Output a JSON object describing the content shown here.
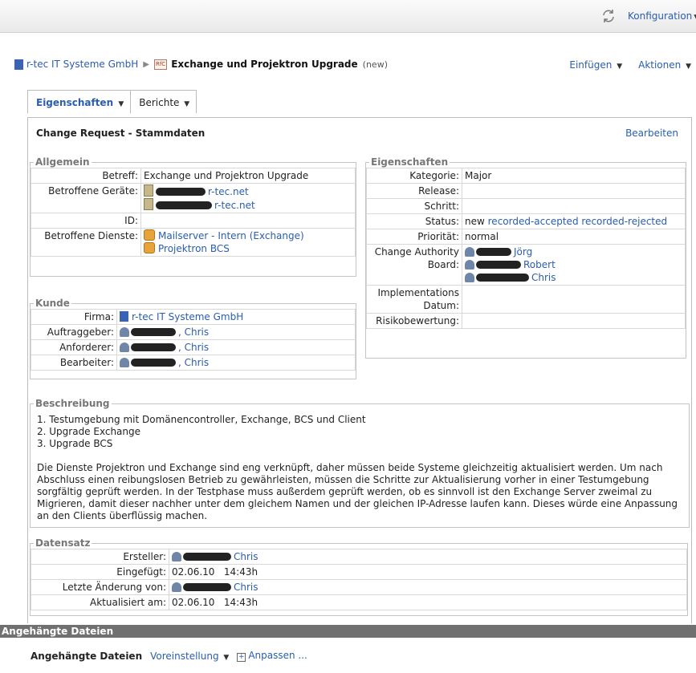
{
  "topbar": {
    "konfiguration": "Konfiguration"
  },
  "breadcrumb": {
    "company": "r-tec IT Systeme GmbH",
    "rfc_badge": "RfC",
    "title": "Exchange und Projektron Upgrade",
    "state": "(new)"
  },
  "actions": {
    "insert": "Einfügen",
    "actions": "Aktionen"
  },
  "tabs": {
    "properties": "Eigenschaften",
    "reports": "Berichte"
  },
  "panel": {
    "title": "Change Request - Stammdaten",
    "edit": "Bearbeiten"
  },
  "allgemein": {
    "legend": "Allgemein",
    "betreff_label": "Betreff:",
    "betreff_value": "Exchange und Projektron Upgrade",
    "geraete_label": "Betroffene Geräte:",
    "geraet1": "r-tec.net",
    "geraet2": "r-tec.net",
    "id_label": "ID:",
    "dienste_label": "Betroffene Dienste:",
    "dienst1": "Mailserver - Intern (Exchange)",
    "dienst2": "Projektron BCS"
  },
  "kunde": {
    "legend": "Kunde",
    "firma_label": "Firma:",
    "firma_value": "r-tec IT Systeme GmbH",
    "auftraggeber_label": "Auftraggeber:",
    "auftraggeber_value": ", Chris",
    "anforderer_label": "Anforderer:",
    "anforderer_value": ", Chris",
    "bearbeiter_label": "Bearbeiter:",
    "bearbeiter_value": ", Chris"
  },
  "eigenschaften": {
    "legend": "Eigenschaften",
    "kategorie_label": "Kategorie:",
    "kategorie_value": "Major",
    "release_label": "Release:",
    "schritt_label": "Schritt:",
    "status_label": "Status:",
    "status_current": "new",
    "status_opt1": "recorded-accepted",
    "status_opt2": "recorded-rejected",
    "prioritaet_label": "Priorität:",
    "prioritaet_value": "normal",
    "cab_label": "Change Authority Board:",
    "cab1": "Jörg",
    "cab2": "Robert",
    "cab3": "Chris",
    "impl_label": "Implementations Datum:",
    "risiko_label": "Risikobewertung:"
  },
  "beschreibung": {
    "legend": "Beschreibung",
    "line1": "1. Testumgebung mit Domänencontroller, Exchange, BCS und Client",
    "line2": "2. Upgrade Exchange",
    "line3": "3. Upgrade BCS",
    "paragraph": "Die Dienste Projektron und Exchange sind eng verknüpft, daher müssen beide Systeme gleichzeitig aktualisiert werden. Um nach Abschluss einen reibungslosen Betrieb zu gewährleisten, müssen die Schritte zur Aktualisierung vorher in einer Testumgebung sorgfältig geprüft werden. In der Testphase muss außerdem geprüft werden, ob es sinnvoll ist den Exchange Server zweimal zu Migrieren, damit dieser nachher unter dem gleichem Namen und der gleichen IP-Adresse laufen kann. Dieses würde eine Anpassung an den Clients überflüssig machen."
  },
  "datensatz": {
    "legend": "Datensatz",
    "ersteller_label": "Ersteller:",
    "ersteller_value": "Chris",
    "eingefuegt_label": "Eingefügt:",
    "eingefuegt_value": "02.06.10   14:43h",
    "letzte_label": "Letzte Änderung von:",
    "letzte_value": "Chris",
    "aktualisiert_label": "Aktualisiert am:",
    "aktualisiert_value": "02.06.10   14:43h"
  },
  "attachments": {
    "bar": "Angehängte Dateien",
    "title": "Angehängte Dateien",
    "preset": "Voreinstellung",
    "customize": "Anpassen ..."
  },
  "icons": [
    "refresh-icon",
    "building-icon",
    "rfc-icon",
    "device-icon",
    "service-icon",
    "person-icon",
    "plus-box-icon"
  ]
}
